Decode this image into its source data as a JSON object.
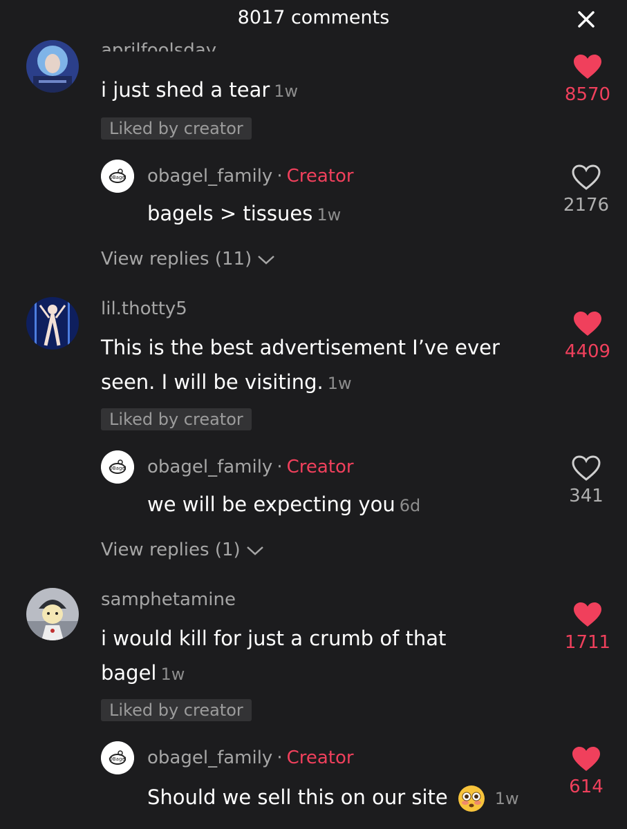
{
  "header": {
    "title": "8017 comments",
    "close_icon": "close-icon"
  },
  "colors": {
    "background": "#1c1c1e",
    "accent": "#f0405c",
    "muted": "#a6a6a6"
  },
  "comments": [
    {
      "username": "aprilfoolsday",
      "text": "i just shed a tear",
      "time": "1w",
      "liked_badge": "Liked by creator",
      "likes": "8570",
      "liked": true,
      "reply": {
        "username": "obagel_family",
        "separator": "·",
        "role": "Creator",
        "text": "bagels > tissues",
        "time": "1w",
        "likes": "2176",
        "liked": false
      },
      "view_replies": "View replies (11)"
    },
    {
      "username": "lil.thotty5",
      "text": "This is the best advertisement I’ve ever seen. I will be visiting.",
      "time": "1w",
      "liked_badge": "Liked by creator",
      "likes": "4409",
      "liked": true,
      "reply": {
        "username": "obagel_family",
        "separator": "·",
        "role": "Creator",
        "text": "we will be expecting you",
        "time": "6d",
        "likes": "341",
        "liked": false
      },
      "view_replies": "View replies (1)"
    },
    {
      "username": "samphetamine",
      "text": "i would kill for just a crumb of that bagel",
      "time": "1w",
      "liked_badge": "Liked by creator",
      "likes": "1711",
      "liked": true,
      "reply": {
        "username": "obagel_family",
        "separator": "·",
        "role": "Creator",
        "text": "Should we sell this on our site",
        "emoji": "flushed-face-emoji",
        "time": "1w",
        "likes": "614",
        "liked": true
      }
    }
  ]
}
